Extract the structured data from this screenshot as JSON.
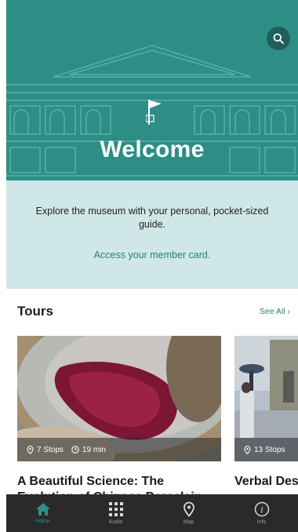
{
  "hero": {
    "title": "Welcome",
    "search_icon": "search-icon",
    "flag_icon": "flag-icon"
  },
  "intro": {
    "text": "Explore the museum with your personal, pocket-sized guide.",
    "member_link": "Access your member card."
  },
  "tours": {
    "title": "Tours",
    "see_all": "See All  ›",
    "cards": [
      {
        "title": "A Beautiful Science: The Evolution of Chinese Porcelain",
        "stops": "7 Stops",
        "duration": "19 min"
      },
      {
        "title": "Verbal Descriptions Essentials",
        "stops": "13 Stops"
      }
    ]
  },
  "nav": {
    "items": [
      {
        "label": "Home",
        "icon": "home-icon",
        "active": true
      },
      {
        "label": "Audio",
        "icon": "keypad-icon"
      },
      {
        "label": "Map",
        "icon": "map-pin-icon"
      },
      {
        "label": "Info",
        "icon": "info-icon"
      }
    ]
  },
  "colors": {
    "teal": "#2d8e86",
    "intro_bg": "#cfe7e7",
    "accent": "#2b7f78",
    "nav_bg": "#2a2a2a"
  }
}
